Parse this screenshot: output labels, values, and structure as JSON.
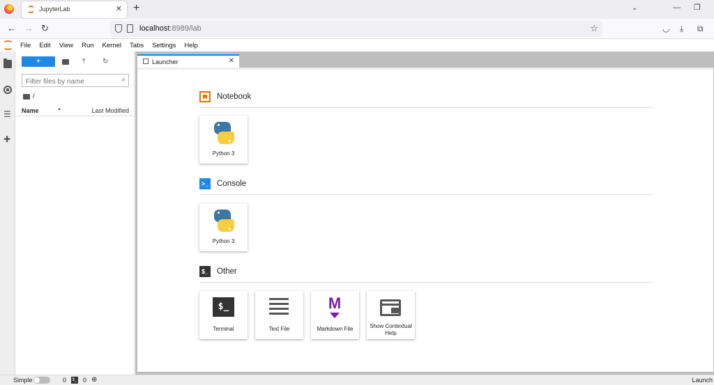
{
  "browser": {
    "tab_title": "JupyterLab",
    "url_host": "localhost",
    "url_rest": ":8989/lab"
  },
  "menu": [
    "File",
    "Edit",
    "View",
    "Run",
    "Kernel",
    "Tabs",
    "Settings",
    "Help"
  ],
  "filebrowser": {
    "new_label": "+",
    "filter_placeholder": "Filter files by name",
    "path": "/",
    "col_name": "Name",
    "col_modified": "Last Modified"
  },
  "launcher": {
    "tab_label": "Launcher",
    "sections": {
      "notebook": {
        "title": "Notebook",
        "items": [
          "Python 3"
        ]
      },
      "console": {
        "title": "Console",
        "items": [
          "Python 3"
        ]
      },
      "other": {
        "title": "Other",
        "items": [
          "Terminal",
          "Text File",
          "Markdown File",
          "Show Contextual Help"
        ]
      }
    }
  },
  "statusbar": {
    "mode": "Simple",
    "kernels": "0",
    "terminals": "0",
    "right_text": "Launch"
  },
  "colors": {
    "accent": "#1e88e5",
    "jupyter_orange": "#f37726",
    "markdown_purple": "#7b1fa2"
  }
}
